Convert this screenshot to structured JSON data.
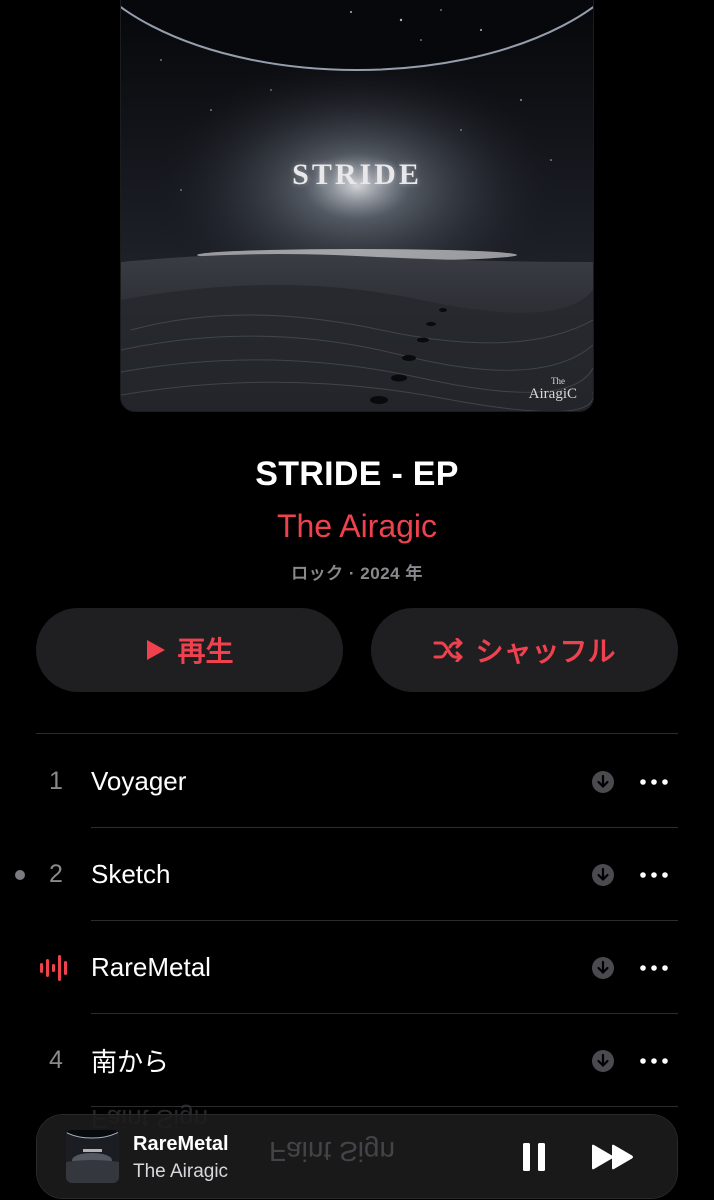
{
  "album": {
    "artwork_title": "STRIDE",
    "artwork_logo_the": "The",
    "artwork_logo_name": "AiragiC",
    "title": "STRIDE - EP",
    "artist": "The Airagic",
    "meta": "ロック · 2024 年"
  },
  "actions": {
    "play_label": "再生",
    "shuffle_label": "シャッフル"
  },
  "tracks": [
    {
      "number": "1",
      "name": "Voyager",
      "state": "normal"
    },
    {
      "number": "2",
      "name": "Sketch",
      "state": "last-played"
    },
    {
      "number": "3",
      "name": "RareMetal",
      "state": "now-playing"
    },
    {
      "number": "4",
      "name": "南から",
      "state": "normal"
    }
  ],
  "ghost_track_text": "Faint Sign",
  "now_playing": {
    "title": "RareMetal",
    "artist": "The Airagic",
    "ghost_text": "Faint Sign"
  },
  "colors": {
    "accent": "#f0414f",
    "background": "#000000",
    "secondary_text": "#8a8a8e",
    "button_bg": "#1f1f21"
  },
  "icons": {
    "play": "play-icon",
    "shuffle": "shuffle-icon",
    "download": "download-icon",
    "more": "more-icon",
    "now_playing": "waveform-icon",
    "pause": "pause-icon",
    "next": "forward-icon"
  }
}
